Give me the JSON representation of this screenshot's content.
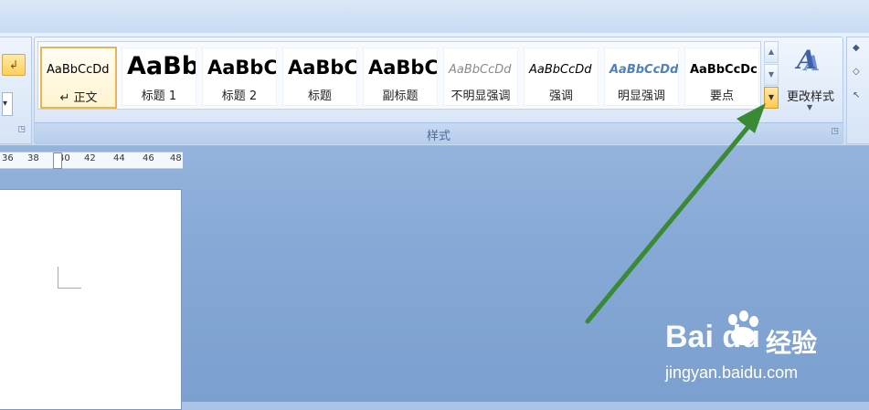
{
  "ribbon": {
    "styles_group_title": "样式",
    "change_styles_label": "更改样式",
    "style_tiles": [
      {
        "sample": "AaBbCcDd",
        "label": "正文",
        "prefix": "↵"
      },
      {
        "sample": "AaBb",
        "label": "标题 1"
      },
      {
        "sample": "AaBbC",
        "label": "标题 2"
      },
      {
        "sample": "AaBbC",
        "label": "标题"
      },
      {
        "sample": "AaBbC",
        "label": "副标题"
      },
      {
        "sample": "AaBbCcDd",
        "label": "不明显强调"
      },
      {
        "sample": "AaBbCcDd",
        "label": "强调"
      },
      {
        "sample": "AaBbCcDd",
        "label": "明显强调"
      },
      {
        "sample": "AaBbCcDc",
        "label": "要点"
      }
    ]
  },
  "ruler": {
    "ticks": [
      "36",
      "38",
      "40",
      "42",
      "44",
      "46",
      "48"
    ]
  },
  "watermark": {
    "logo": "Bai du",
    "brand_text": "经验",
    "url": "jingyan.baidu.com"
  },
  "colors": {
    "arrow": "#3a8a35",
    "selected_tile_border": "#e8b454",
    "more_button": "#ffc94d"
  }
}
